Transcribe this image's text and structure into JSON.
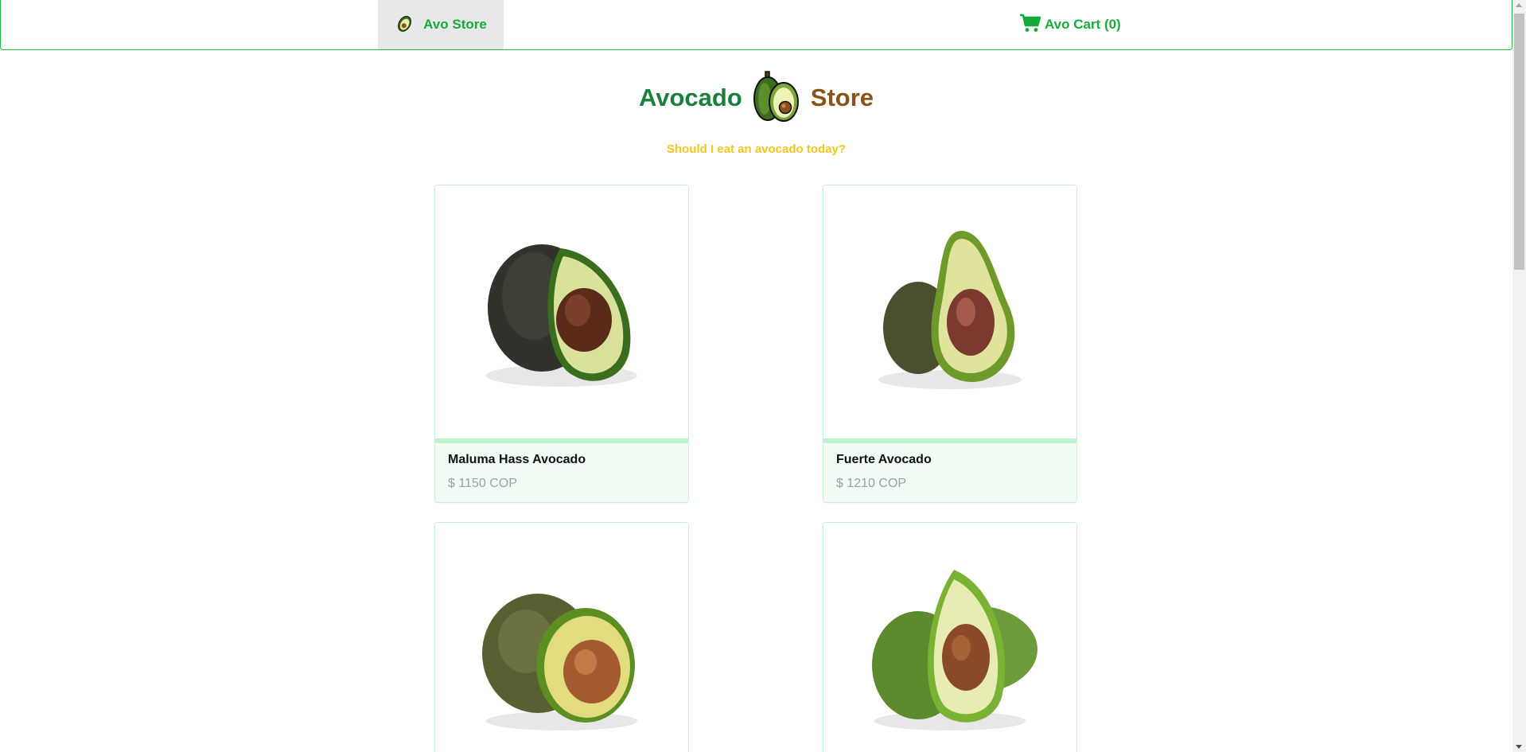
{
  "nav": {
    "home_label": "Avo Store",
    "cart_label": "Avo Cart (0)"
  },
  "hero": {
    "word1": "Avocado",
    "word2": "Store",
    "tagline": "Should I eat an avocado today?"
  },
  "products": [
    {
      "name": "Maluma Hass Avocado",
      "price": "$ 1150 COP"
    },
    {
      "name": "Fuerte Avocado",
      "price": "$ 1210 COP"
    },
    {
      "name": "",
      "price": ""
    },
    {
      "name": "",
      "price": ""
    }
  ],
  "colors": {
    "accent": "#16ab39",
    "brand_green": "#1a7f3c",
    "brand_brown": "#8a5217",
    "tagline": "#f2c61f"
  },
  "icons": {
    "home": "avocado-icon",
    "cart": "cart-icon",
    "logo": "avocado-logo"
  }
}
